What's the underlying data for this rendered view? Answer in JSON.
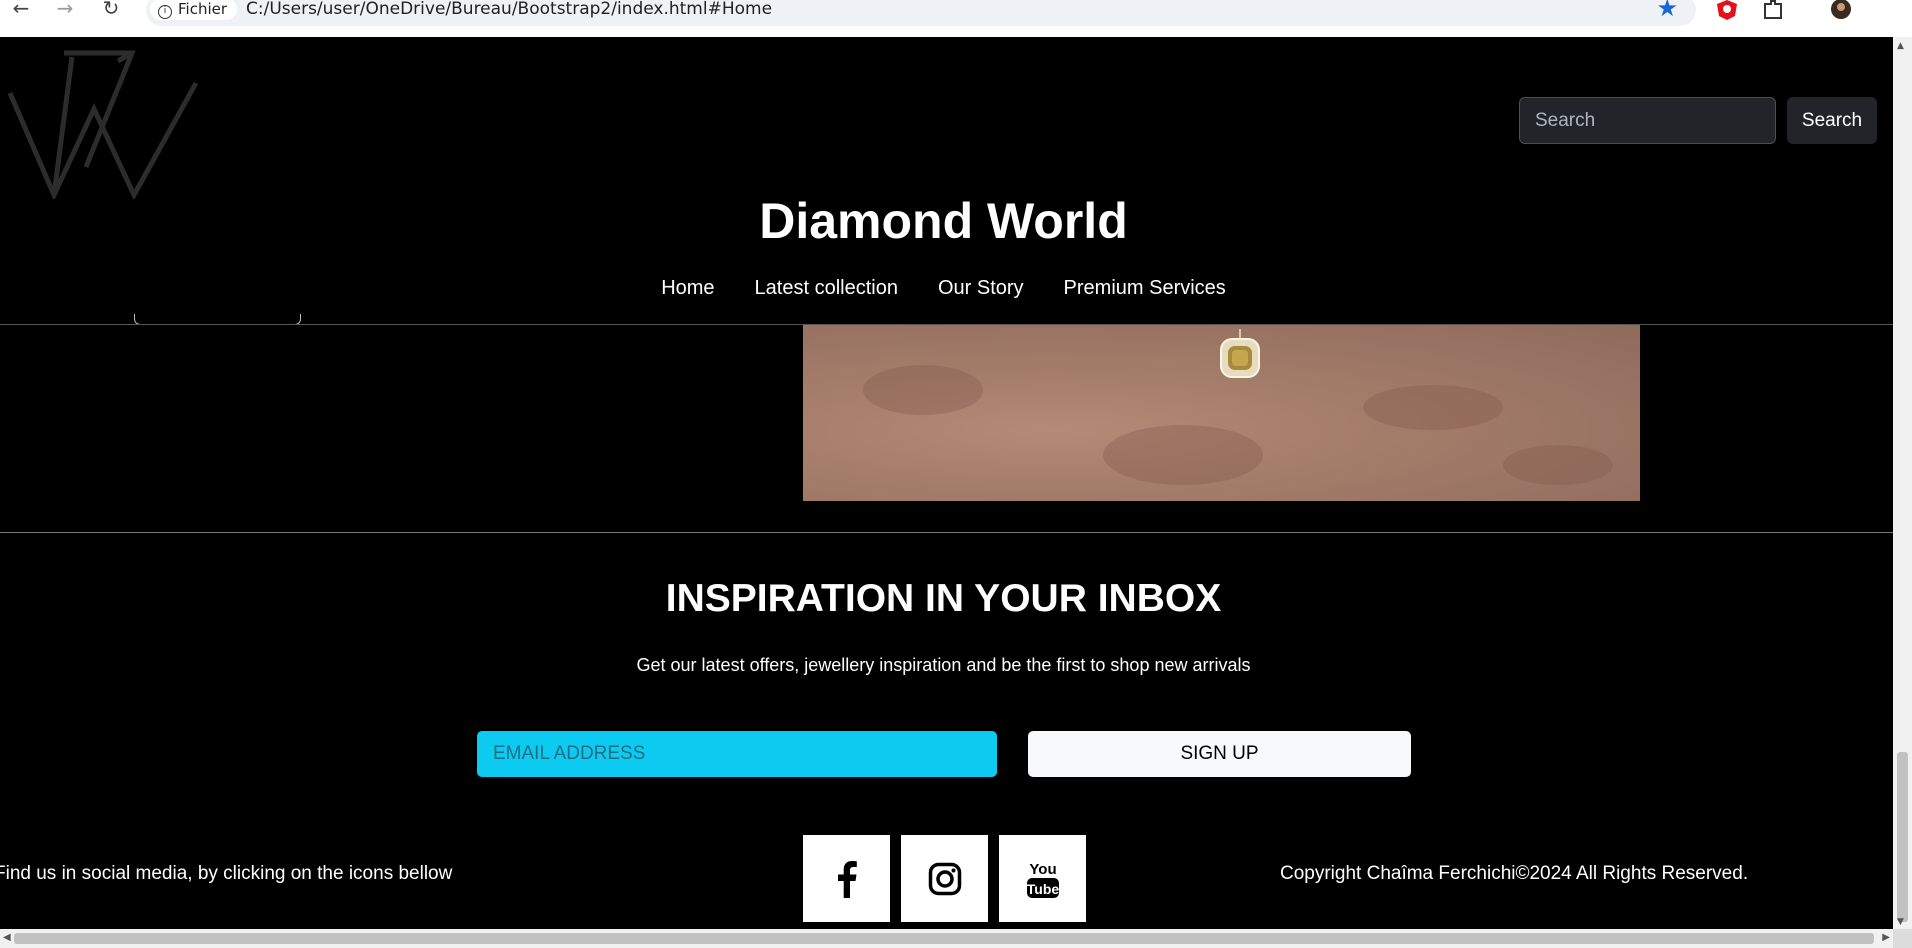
{
  "browser": {
    "site_chip": "Fichier",
    "url": "C:/Users/user/OneDrive/Bureau/Bootstrap2/index.html#Home"
  },
  "header": {
    "search_placeholder": "Search",
    "search_button": "Search",
    "title": "Diamond World",
    "menu": [
      {
        "label": "Home"
      },
      {
        "label": "Latest collection"
      },
      {
        "label": "Our Story"
      },
      {
        "label": "Premium Services"
      }
    ]
  },
  "newsletter": {
    "title": "INSPIRATION IN YOUR INBOX",
    "subtitle": "Get our latest offers, jewellery inspiration and be the first to shop new arrivals",
    "email_placeholder": "EMAIL ADDRESS",
    "signup_label": "SIGN UP"
  },
  "footer": {
    "social_text": "Find us in social media, by clicking on the icons bellow",
    "social_icons": [
      "facebook-icon",
      "instagram-icon",
      "youtube-icon"
    ],
    "youtube_label_top": "You",
    "youtube_label_bottom": "Tube",
    "copyright": "Copyright Chaîma Ferchichi©2024 All Rights Reserved."
  },
  "colors": {
    "background": "#000000",
    "accent_email": "#0dcaf0",
    "bookmark_star": "#1a66d6"
  }
}
